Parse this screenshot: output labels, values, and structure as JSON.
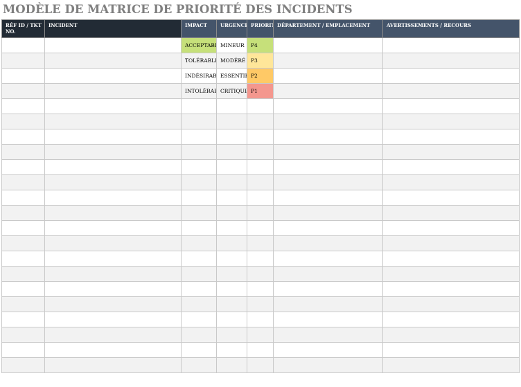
{
  "title": "MODÈLE DE MATRICE DE PRIORITÉ DES INCIDENTS",
  "headers": {
    "ref": "RÉF ID / TKT NO.",
    "incident": "INCIDENT",
    "impact": "IMPACT",
    "urgence": "URGENCE",
    "priorite": "PRIORITÉ",
    "departement": "DÉPARTEMENT / EMPLACEMENT",
    "avertissements": "AVERTISSEMENTS / RECOURS"
  },
  "matrix": [
    {
      "impact": "ACCEPTABLE",
      "urgence": "MINEUR",
      "priorite": "P4",
      "impact_color": "#c6e07a",
      "priorite_color": "#c6e07a"
    },
    {
      "impact": "TOLÉRABLE",
      "urgence": "MODÉRÉ",
      "priorite": "P3",
      "impact_color": "",
      "priorite_color": "#ffe699"
    },
    {
      "impact": "INDÉSIRABLE",
      "urgence": "ESSENTIEL",
      "priorite": "P2",
      "impact_color": "",
      "priorite_color": "#ffc966"
    },
    {
      "impact": "INTOLÉRABLE",
      "urgence": "CRITIQUE",
      "priorite": "P1",
      "impact_color": "",
      "priorite_color": "#f4978e"
    }
  ],
  "colors": {
    "header_dark": "#222b35",
    "header_slate": "#44546a",
    "stripe": "#f2f2f2",
    "title": "#7f7f7f"
  }
}
